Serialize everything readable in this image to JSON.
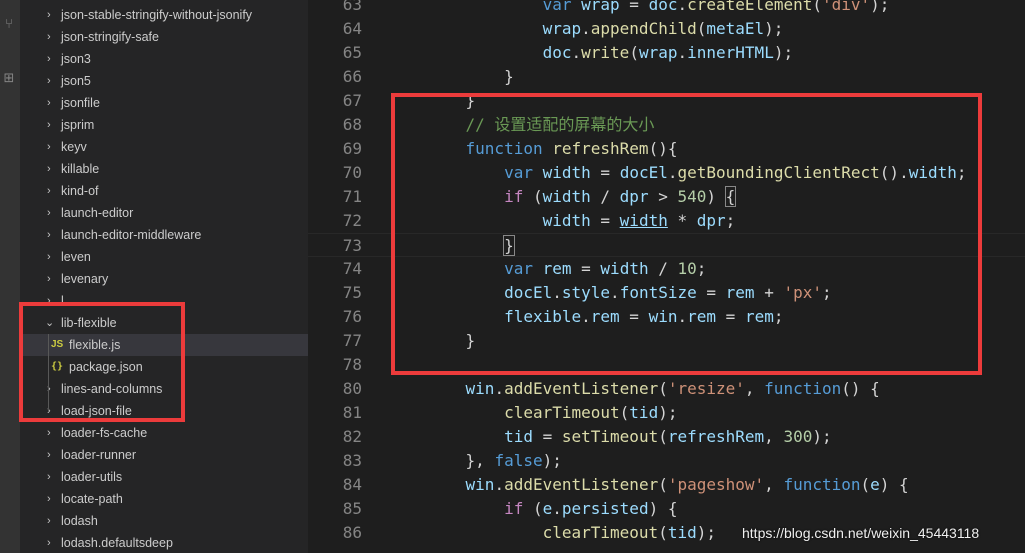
{
  "activity_bar": {
    "icons": [
      "source-control-icon",
      "extensions-icon"
    ]
  },
  "explorer": {
    "rows": [
      {
        "label": "json-stable-stringify-without-jsonify",
        "kind": "folder"
      },
      {
        "label": "json-stringify-safe",
        "kind": "folder"
      },
      {
        "label": "json3",
        "kind": "folder"
      },
      {
        "label": "json5",
        "kind": "folder"
      },
      {
        "label": "jsonfile",
        "kind": "folder"
      },
      {
        "label": "jsprim",
        "kind": "folder"
      },
      {
        "label": "keyv",
        "kind": "folder"
      },
      {
        "label": "killable",
        "kind": "folder"
      },
      {
        "label": "kind-of",
        "kind": "folder"
      },
      {
        "label": "launch-editor",
        "kind": "folder"
      },
      {
        "label": "launch-editor-middleware",
        "kind": "folder"
      },
      {
        "label": "leven",
        "kind": "folder"
      },
      {
        "label": "levenary",
        "kind": "folder"
      },
      {
        "label": "l",
        "kind": "folder"
      },
      {
        "label": "lib-flexible",
        "kind": "folder-open"
      },
      {
        "label": "flexible.js",
        "kind": "js",
        "icon": "JS",
        "selected": true
      },
      {
        "label": "package.json",
        "kind": "json",
        "icon": "{}"
      },
      {
        "label": "lines-and-columns",
        "kind": "folder"
      },
      {
        "label": "load-json-file",
        "kind": "folder"
      },
      {
        "label": "loader-fs-cache",
        "kind": "folder"
      },
      {
        "label": "loader-runner",
        "kind": "folder"
      },
      {
        "label": "loader-utils",
        "kind": "folder"
      },
      {
        "label": "locate-path",
        "kind": "folder"
      },
      {
        "label": "lodash",
        "kind": "folder"
      },
      {
        "label": "lodash.defaultsdeep",
        "kind": "folder"
      }
    ]
  },
  "editor": {
    "lines": [
      {
        "n": "63",
        "tokens": [
          [
            "",
            "            "
          ],
          [
            "kw",
            "var"
          ],
          [
            "",
            " "
          ],
          [
            "var",
            "wrap"
          ],
          [
            "",
            " = "
          ],
          [
            "var",
            "doc"
          ],
          [
            "",
            "."
          ],
          [
            "fn",
            "createElement"
          ],
          [
            "",
            "("
          ],
          [
            "str",
            "'div'"
          ],
          [
            "",
            ");"
          ]
        ]
      },
      {
        "n": "64",
        "tokens": [
          [
            "",
            "            "
          ],
          [
            "var",
            "wrap"
          ],
          [
            "",
            "."
          ],
          [
            "fn",
            "appendChild"
          ],
          [
            "",
            "("
          ],
          [
            "var",
            "metaEl"
          ],
          [
            "",
            ");"
          ]
        ]
      },
      {
        "n": "65",
        "tokens": [
          [
            "",
            "            "
          ],
          [
            "var",
            "doc"
          ],
          [
            "",
            "."
          ],
          [
            "fn",
            "write"
          ],
          [
            "",
            "("
          ],
          [
            "var",
            "wrap"
          ],
          [
            "",
            "."
          ],
          [
            "var",
            "innerHTML"
          ],
          [
            "",
            ");"
          ]
        ]
      },
      {
        "n": "66",
        "tokens": [
          [
            "",
            "        }"
          ]
        ]
      },
      {
        "n": "67",
        "tokens": [
          [
            "",
            "    }"
          ]
        ]
      },
      {
        "n": "68",
        "tokens": [
          [
            "",
            "    "
          ],
          [
            "cm",
            "// 设置适配的屏幕的大小"
          ]
        ]
      },
      {
        "n": "69",
        "tokens": [
          [
            "",
            "    "
          ],
          [
            "kw",
            "function"
          ],
          [
            "",
            " "
          ],
          [
            "fn",
            "refreshRem"
          ],
          [
            "",
            "(){"
          ]
        ]
      },
      {
        "n": "70",
        "tokens": [
          [
            "",
            "        "
          ],
          [
            "kw",
            "var"
          ],
          [
            "",
            " "
          ],
          [
            "var",
            "width"
          ],
          [
            "",
            " = "
          ],
          [
            "var",
            "docEl"
          ],
          [
            "",
            "."
          ],
          [
            "fn",
            "getBoundingClientRect"
          ],
          [
            "",
            "()."
          ],
          [
            "var",
            "width"
          ],
          [
            "",
            ";"
          ]
        ]
      },
      {
        "n": "71",
        "tokens": [
          [
            "",
            "        "
          ],
          [
            "ctl",
            "if"
          ],
          [
            "",
            " ("
          ],
          [
            "var",
            "width"
          ],
          [
            "",
            " / "
          ],
          [
            "var",
            "dpr"
          ],
          [
            "",
            " > "
          ],
          [
            "num",
            "540"
          ],
          [
            "",
            ") "
          ],
          [
            "bm",
            "{"
          ]
        ]
      },
      {
        "n": "72",
        "tokens": [
          [
            "",
            "            "
          ],
          [
            "var",
            "width"
          ],
          [
            "",
            " = "
          ],
          [
            "link",
            "width"
          ],
          [
            "",
            " * "
          ],
          [
            "var",
            "dpr"
          ],
          [
            "",
            ";"
          ]
        ]
      },
      {
        "n": "73",
        "tokens": [
          [
            "",
            "        "
          ],
          [
            "bm",
            "}"
          ]
        ],
        "current": true
      },
      {
        "n": "74",
        "tokens": [
          [
            "",
            "        "
          ],
          [
            "kw",
            "var"
          ],
          [
            "",
            " "
          ],
          [
            "var",
            "rem"
          ],
          [
            "",
            " = "
          ],
          [
            "var",
            "width"
          ],
          [
            "",
            " / "
          ],
          [
            "num",
            "10"
          ],
          [
            "",
            ";"
          ]
        ]
      },
      {
        "n": "75",
        "tokens": [
          [
            "",
            "        "
          ],
          [
            "var",
            "docEl"
          ],
          [
            "",
            "."
          ],
          [
            "var",
            "style"
          ],
          [
            "",
            "."
          ],
          [
            "var",
            "fontSize"
          ],
          [
            "",
            " = "
          ],
          [
            "var",
            "rem"
          ],
          [
            "",
            " + "
          ],
          [
            "str",
            "'px'"
          ],
          [
            "",
            ";"
          ]
        ]
      },
      {
        "n": "76",
        "tokens": [
          [
            "",
            "        "
          ],
          [
            "var",
            "flexible"
          ],
          [
            "",
            "."
          ],
          [
            "var",
            "rem"
          ],
          [
            "",
            " = "
          ],
          [
            "var",
            "win"
          ],
          [
            "",
            "."
          ],
          [
            "var",
            "rem"
          ],
          [
            "",
            " = "
          ],
          [
            "var",
            "rem"
          ],
          [
            "",
            ";"
          ]
        ]
      },
      {
        "n": "77",
        "tokens": [
          [
            "",
            "    }"
          ]
        ]
      },
      {
        "n": "78",
        "tokens": []
      },
      {
        "n": "80",
        "tokens": [
          [
            "",
            "    "
          ],
          [
            "var",
            "win"
          ],
          [
            "",
            "."
          ],
          [
            "fn",
            "addEventListener"
          ],
          [
            "",
            "("
          ],
          [
            "str",
            "'resize'"
          ],
          [
            "",
            ", "
          ],
          [
            "kw",
            "function"
          ],
          [
            "",
            "() {"
          ]
        ]
      },
      {
        "n": "81",
        "tokens": [
          [
            "",
            "        "
          ],
          [
            "fn",
            "clearTimeout"
          ],
          [
            "",
            "("
          ],
          [
            "var",
            "tid"
          ],
          [
            "",
            ");"
          ]
        ]
      },
      {
        "n": "82",
        "tokens": [
          [
            "",
            "        "
          ],
          [
            "var",
            "tid"
          ],
          [
            "",
            " = "
          ],
          [
            "fn",
            "setTimeout"
          ],
          [
            "",
            "("
          ],
          [
            "var",
            "refreshRem"
          ],
          [
            "",
            ", "
          ],
          [
            "num",
            "300"
          ],
          [
            "",
            ");"
          ]
        ]
      },
      {
        "n": "83",
        "tokens": [
          [
            "",
            "    }, "
          ],
          [
            "kw",
            "false"
          ],
          [
            "",
            ");"
          ]
        ]
      },
      {
        "n": "84",
        "tokens": [
          [
            "",
            "    "
          ],
          [
            "var",
            "win"
          ],
          [
            "",
            "."
          ],
          [
            "fn",
            "addEventListener"
          ],
          [
            "",
            "("
          ],
          [
            "str",
            "'pageshow'"
          ],
          [
            "",
            ", "
          ],
          [
            "kw",
            "function"
          ],
          [
            "",
            "("
          ],
          [
            "var",
            "e"
          ],
          [
            "",
            ") {"
          ]
        ]
      },
      {
        "n": "85",
        "tokens": [
          [
            "",
            "        "
          ],
          [
            "ctl",
            "if"
          ],
          [
            "",
            " ("
          ],
          [
            "var",
            "e"
          ],
          [
            "",
            "."
          ],
          [
            "var",
            "persisted"
          ],
          [
            "",
            ") {"
          ]
        ]
      },
      {
        "n": "86",
        "tokens": [
          [
            "",
            "            "
          ],
          [
            "fn",
            "clearTimeout"
          ],
          [
            "",
            "("
          ],
          [
            "var",
            "tid"
          ],
          [
            "",
            ");"
          ]
        ]
      }
    ]
  },
  "annotation": {
    "color": "#ec3b3b"
  },
  "watermark": "https://blog.csdn.net/weixin_45443118"
}
